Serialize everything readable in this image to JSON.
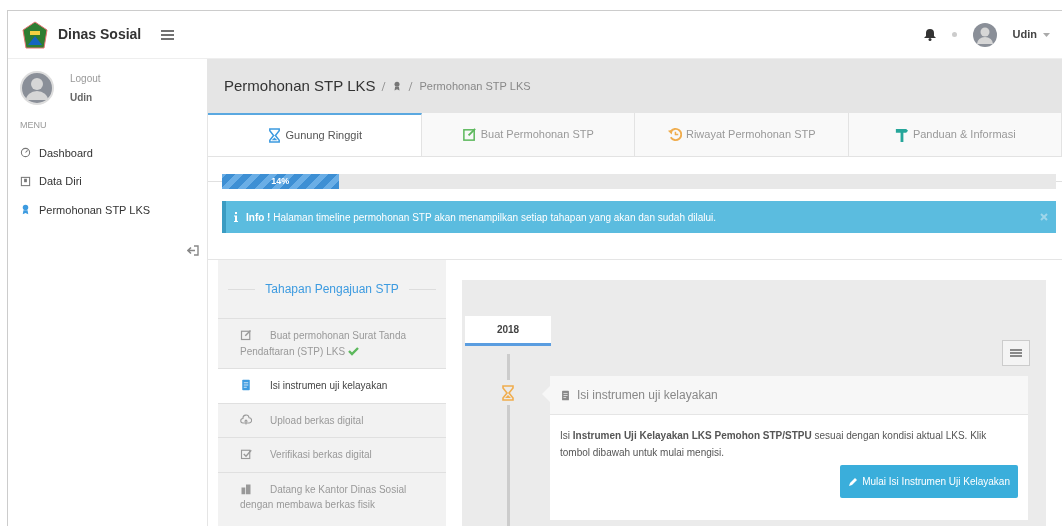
{
  "brand": {
    "title": "Dinas Sosial"
  },
  "topbar": {
    "user": "Udin"
  },
  "sidebar": {
    "logout": "Logout",
    "user": "Udin",
    "menu_label": "MENU",
    "items": [
      {
        "label": "Dashboard",
        "selected": false
      },
      {
        "label": "Data Diri",
        "selected": false
      },
      {
        "label": "Permohonan STP LKS",
        "selected": true
      }
    ]
  },
  "header": {
    "title": "Permohonan STP LKS",
    "breadcrumb": "Permohonan STP LKS"
  },
  "tabs": [
    {
      "label": "Gunung Ringgit",
      "selected": true
    },
    {
      "label": "Buat Permohonan STP",
      "selected": false
    },
    {
      "label": "Riwayat Permohonan STP",
      "selected": false
    },
    {
      "label": "Panduan & Informasi",
      "selected": false
    }
  ],
  "progress": {
    "level": 0.14,
    "label": "14%"
  },
  "alert": {
    "title": "Info !",
    "text": "Halaman timeline permohonan STP akan menampilkan setiap tahapan yang akan dan sudah dilalui."
  },
  "steps": {
    "title": "Tahapan Pengajuan STP",
    "items": [
      {
        "label": "Buat permohonan Surat Tanda Pendaftaran (STP) LKS",
        "selected": false,
        "done": true
      },
      {
        "label": "Isi instrumen uji kelayakan",
        "selected": true,
        "done": false
      },
      {
        "label": "Upload berkas digital",
        "selected": false,
        "done": false
      },
      {
        "label": "Verifikasi berkas digital",
        "selected": false,
        "done": false
      },
      {
        "label": "Datang ke Kantor Dinas Sosial dengan membawa berkas fisik",
        "selected": false,
        "done": false
      }
    ]
  },
  "timeline": {
    "year": "2018",
    "entry": {
      "title": "Isi instrumen uji kelayakan",
      "body": "Isi **Instrumen Uji Kelayakan LKS Pemohon STP/STPU** sesuai dengan kondisi aktual LKS. Klik tombol dibawah untuk mulai mengisi.",
      "button": "Mulai Isi Instrumen Uji Kelayakan"
    }
  }
}
